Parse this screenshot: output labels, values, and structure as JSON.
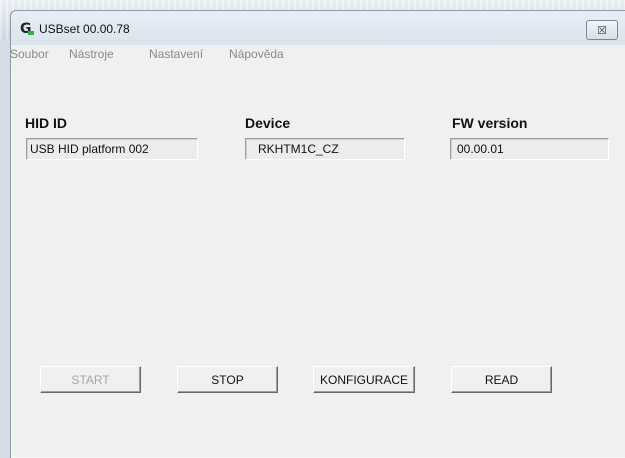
{
  "window": {
    "title": "USBset 00.00.78",
    "icon": "g-app-icon",
    "close_symbol": "☒"
  },
  "menu": {
    "items": [
      "Soubor",
      "Nástroje",
      "Nastavení",
      "Nápověda"
    ]
  },
  "fields": {
    "hid_id": {
      "label": "HID ID",
      "value": "USB HID platform 002"
    },
    "device": {
      "label": "Device",
      "value": "RKHTM1C_CZ"
    },
    "fw_version": {
      "label": "FW version",
      "value": "00.00.01"
    }
  },
  "buttons": {
    "start": "START",
    "stop": "STOP",
    "konfigurace": "KONFIGURACE",
    "read": "READ"
  }
}
